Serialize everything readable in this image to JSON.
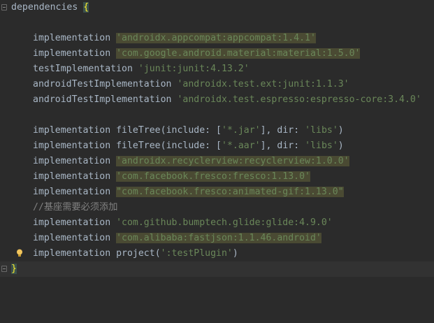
{
  "editor": {
    "header": {
      "keyword": "dependencies",
      "open_brace": "{"
    },
    "lines": [
      {
        "kind": "blank"
      },
      {
        "kind": "dep",
        "method": "implementation",
        "arg": "'androidx.appcompat:appcompat:1.4.1'",
        "highlight": true
      },
      {
        "kind": "dep",
        "method": "implementation",
        "arg": "'com.google.android.material:material:1.5.0'",
        "highlight": true
      },
      {
        "kind": "dep",
        "method": "testImplementation",
        "arg": "'junit:junit:4.13.2'",
        "highlight": false
      },
      {
        "kind": "dep",
        "method": "androidTestImplementation",
        "arg": "'androidx.test.ext:junit:1.1.3'",
        "highlight": false
      },
      {
        "kind": "dep",
        "method": "androidTestImplementation",
        "arg": "'androidx.test.espresso:espresso-core:3.4.0'",
        "highlight": false
      },
      {
        "kind": "blank"
      },
      {
        "kind": "filetree",
        "method": "implementation",
        "call": "fileTree",
        "include_label": "include",
        "include_val": "'*.jar'",
        "dir_label": "dir",
        "dir_val": "'libs'"
      },
      {
        "kind": "filetree",
        "method": "implementation",
        "call": "fileTree",
        "include_label": "include",
        "include_val": "'*.aar'",
        "dir_label": "dir",
        "dir_val": "'libs'"
      },
      {
        "kind": "dep",
        "method": "implementation",
        "arg": "'androidx.recyclerview:recyclerview:1.0.0'",
        "highlight": true
      },
      {
        "kind": "dep",
        "method": "implementation",
        "arg": "'com.facebook.fresco:fresco:1.13.0'",
        "highlight": true
      },
      {
        "kind": "dep",
        "method": "implementation",
        "arg": "\"com.facebook.fresco:animated-gif:1.13.0\"",
        "highlight": true
      },
      {
        "kind": "comment",
        "text": "//基座需要必须添加"
      },
      {
        "kind": "dep",
        "method": "implementation",
        "arg": "'com.github.bumptech.glide:glide:4.9.0'",
        "highlight": false
      },
      {
        "kind": "dep",
        "method": "implementation",
        "arg": "'com.alibaba:fastjson:1.1.46.android'",
        "highlight": true
      },
      {
        "kind": "project",
        "method": "implementation",
        "call": "project",
        "arg": "':testPlugin'"
      }
    ],
    "close_brace": "}",
    "colors": {
      "background": "#2b2b2b",
      "string": "#6a8759",
      "highlight": "#4a4a33",
      "underline": "#e0212b"
    },
    "icons": [
      "lightbulb-icon",
      "fold-icon"
    ]
  }
}
